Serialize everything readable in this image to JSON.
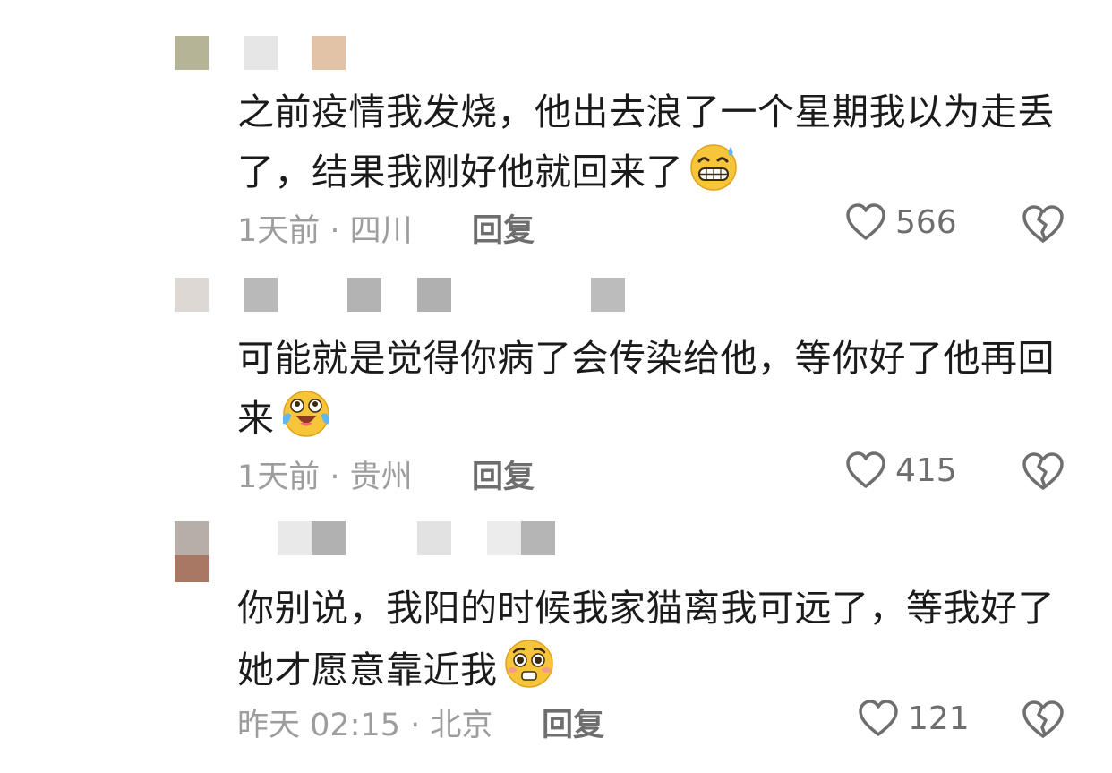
{
  "comments": [
    {
      "text": "之前疫情我发烧，他出去浪了一个星期我以为走丢了，结果我刚好他就回来了",
      "emoji": "grinning-sweat-emoji",
      "time": "1天前",
      "location": "四川",
      "reply_label": "回复",
      "likes": "566",
      "avatar_color": "#b5b496"
    },
    {
      "text": "可能就是觉得你病了会传染给他，等你好了他再回来",
      "emoji": "crying-laughing-emoji",
      "time": "1天前",
      "location": "贵州",
      "reply_label": "回复",
      "likes": "415",
      "avatar_color": "#ddd8d4"
    },
    {
      "text": "你别说，我阳的时候我家猫离我可远了，等我好了她才愿意靠近我",
      "emoji": "pleading-emoji",
      "time": "昨天 02:15",
      "location": "北京",
      "reply_label": "回复",
      "likes": "121",
      "avatar_color": "#b8aea8"
    }
  ]
}
